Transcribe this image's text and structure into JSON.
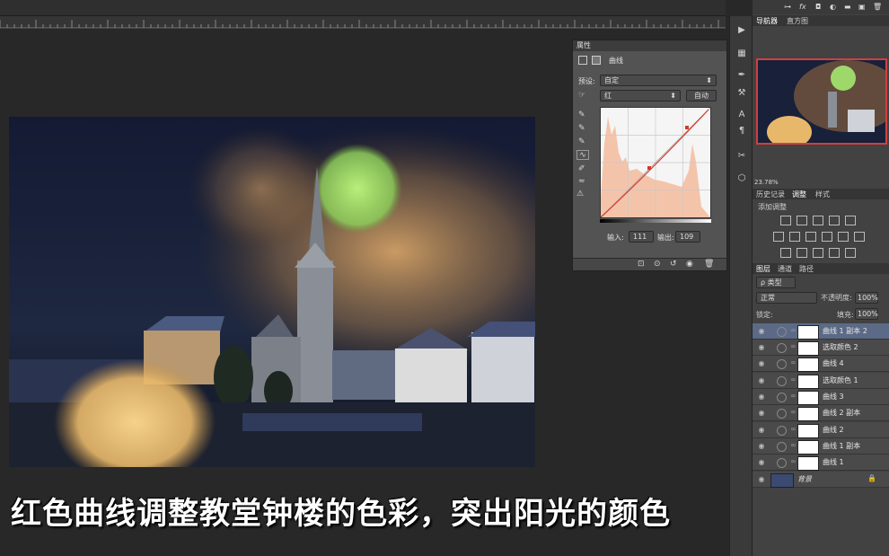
{
  "properties": {
    "title": "属性",
    "panel_name": "曲线",
    "preset_label": "预设:",
    "preset_value": "自定",
    "channel_value": "红",
    "auto_button": "自动",
    "input_label": "输入:",
    "input_value": "111",
    "output_label": "输出:",
    "output_value": "109"
  },
  "navigator": {
    "tabs": [
      "导航器",
      "直方图"
    ],
    "zoom": "23.78%"
  },
  "adjustments": {
    "tabs": [
      "历史记录",
      "调整",
      "样式"
    ],
    "add_label": "添加调整"
  },
  "layers": {
    "tabs": [
      "图层",
      "通道",
      "路径"
    ],
    "filter_value": "ρ 类型",
    "blend_mode": "正常",
    "opacity_label": "不透明度:",
    "opacity_value": "100%",
    "lock_label": "锁定:",
    "fill_label": "填充:",
    "fill_value": "100%",
    "items": [
      {
        "name": "曲线 1 副本 2"
      },
      {
        "name": "选取颜色 2"
      },
      {
        "name": "曲线 4"
      },
      {
        "name": "选取颜色 1"
      },
      {
        "name": "曲线 3"
      },
      {
        "name": "曲线 2 副本"
      },
      {
        "name": "曲线 2"
      },
      {
        "name": "曲线 1 副本"
      },
      {
        "name": "曲线 1"
      },
      {
        "name": "背景"
      }
    ]
  },
  "caption": "红色曲线调整教堂钟楼的色彩，突出阳光的颜色"
}
